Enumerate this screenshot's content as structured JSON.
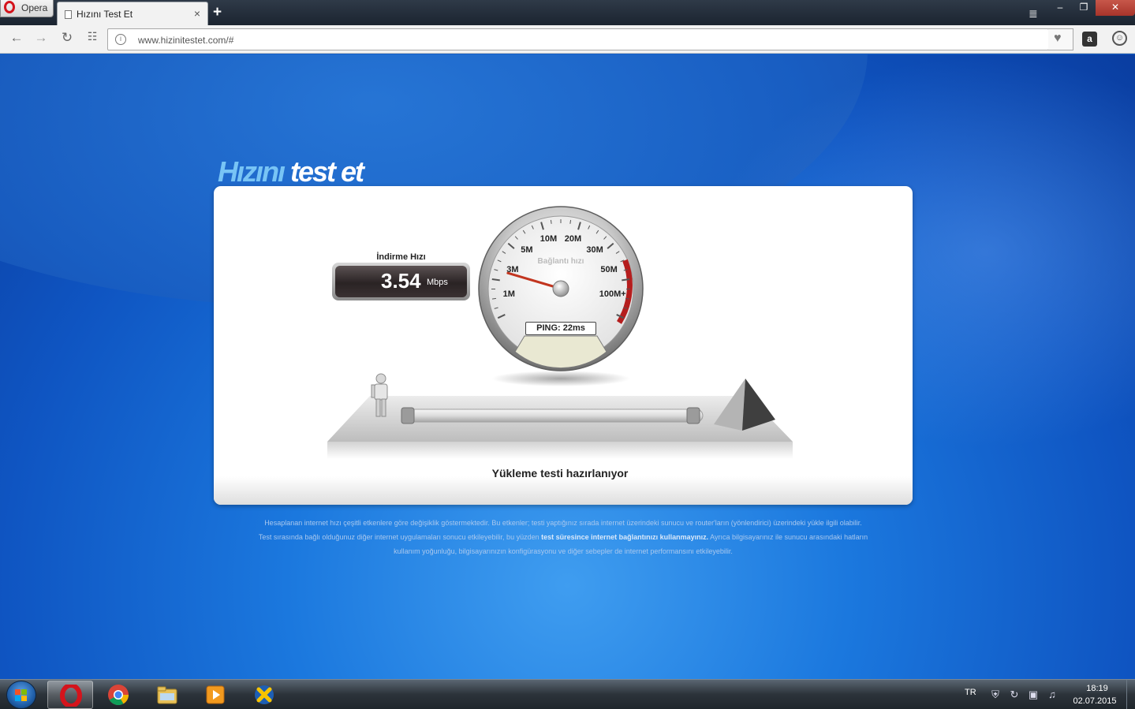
{
  "browser": {
    "menu_label": "Opera",
    "tab_title": "Hızını Test Et",
    "tab_close": "×",
    "new_tab": "+",
    "url": "www.hizinitestet.com/#",
    "window_controls": [
      "–",
      "❐",
      "✕"
    ]
  },
  "site": {
    "logo_part1": "Hızını",
    "logo_part2": " test et"
  },
  "speedtest": {
    "download_label": "İndirme Hızı",
    "download_value": "3.54",
    "download_unit": "Mbps",
    "gauge_title": "Bağlantı hızı",
    "gauge_ticks": [
      "1M",
      "3M",
      "5M",
      "10M",
      "20M",
      "30M",
      "50M",
      "100M+"
    ],
    "gauge_needle_value_fraction": 0.18,
    "ping_text": "PING: 22ms",
    "progress_fraction": 0.0,
    "status": "Yükleme testi hazırlanıyor"
  },
  "disclaimer": {
    "line1": "Hesaplanan internet hızı çeşitli etkenlere göre değişiklik göstermektedir. Bu etkenler; testi yaptığınız sırada internet üzerindeki sunucu ve router'ların (yönlendirici) üzerindeki yükle ilgili olabilir.",
    "line2_pre": "Test sırasında bağlı olduğunuz diğer internet uygulamaları sonucu etkileyebilir, bu yüzden ",
    "line2_bold": "test süresince internet bağlantınızı kullanmayınız.",
    "line2_post": " Ayrıca bilgisayarınız ile sunucu arasındaki hatların",
    "line3": "kullanım yoğunluğu, bilgisayarınızın konfigürasyonu ve diğer sebepler de internet performansını etkileyebilir."
  },
  "taskbar": {
    "language": "TR",
    "time": "18:19",
    "date": "02.07.2015",
    "apps": [
      "opera-icon",
      "chrome-icon",
      "file-explorer-icon",
      "media-player-icon",
      "xampp-icon"
    ]
  },
  "colors": {
    "accent_red": "#b51d1d",
    "page_blue": "#1560c8",
    "logo_light_blue": "#78c4f5"
  }
}
